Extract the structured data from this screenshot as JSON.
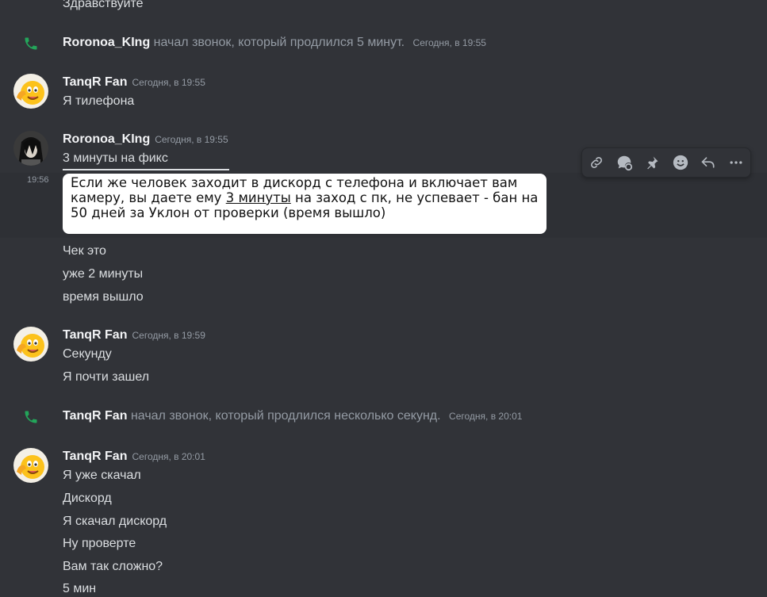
{
  "colors": {
    "background": "#313338",
    "call_icon": "#23a55a",
    "muted": "#949ba4",
    "author": "#f2f3f5"
  },
  "top_partial": {
    "text": "Здравствуйте"
  },
  "call1": {
    "icon": "phone-icon",
    "author": "Roronoa_KIng",
    "text": "начал звонок, который продлился 5 минут.",
    "timestamp": "Сегодня, в 19:55"
  },
  "msg_tanqr1": {
    "author": "TanqR Fan",
    "timestamp": "Сегодня, в 19:55",
    "lines": [
      "Я тилефона"
    ]
  },
  "msg_roronoa": {
    "author": "Roronoa_KIng",
    "timestamp": "Сегодня, в 19:55",
    "lines": [
      "3 минуты на фикс"
    ],
    "hover_time": "19:56",
    "image_caption": {
      "part1": "Если же человек заходит в дискорд с телефона и включает вам камеру, вы даете ему ",
      "underlined": "3 минуты",
      "part2": " на заход с пк, не успевает - бан на 50 дней за Уклон от проверки (время вышло)"
    },
    "followups": [
      "Чек это",
      "уже 2 минуты",
      "время вышло"
    ]
  },
  "msg_tanqr2": {
    "author": "TanqR Fan",
    "timestamp": "Сегодня, в 19:59",
    "lines": [
      "Секунду",
      "Я почти зашел"
    ]
  },
  "call2": {
    "icon": "phone-icon",
    "author": "TanqR Fan",
    "text": "начал звонок, который продлился несколько секунд.",
    "timestamp": "Сегодня, в 20:01"
  },
  "msg_tanqr3": {
    "author": "TanqR Fan",
    "timestamp": "Сегодня, в 20:01",
    "lines": [
      "Я уже скачал",
      "Дискорд",
      "Я скачал дискорд",
      "Ну проверте",
      "Вам так сложно?",
      "5 мин"
    ]
  },
  "toolbar": {
    "buttons": [
      "link-icon",
      "thread-icon",
      "pin-icon",
      "emoji-icon",
      "reply-icon",
      "more-icon"
    ]
  }
}
